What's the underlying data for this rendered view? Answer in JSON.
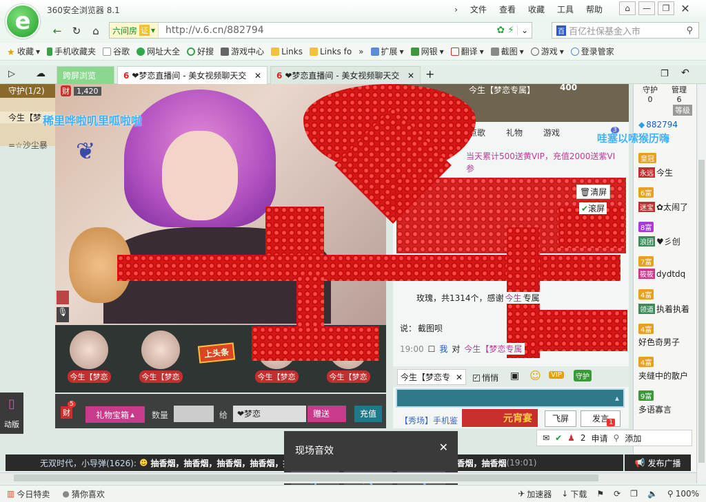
{
  "browser": {
    "title": "360安全浏览器 8.1",
    "logo_letter": "e",
    "menu": [
      "文件",
      "查看",
      "收藏",
      "工具",
      "帮助"
    ],
    "site_badge": "六间房",
    "site_badge_tag": "证",
    "url": "http://v.6.cn/882794",
    "search_placeholder": "百亿社保基金入市",
    "bookmarks": [
      "收藏",
      "手机收藏夹",
      "谷歌",
      "网址大全",
      "好搜",
      "游戏中心",
      "Links",
      "Links fo",
      "扩展",
      "网银",
      "翻译",
      "截图",
      "游戏",
      "登录管家"
    ],
    "tabs": [
      {
        "label": "跨屏浏览"
      },
      {
        "label": "❤梦恋直播间 - 美女视频聊天交"
      },
      {
        "label": "❤梦恋直播间 - 美女视频聊天交"
      }
    ]
  },
  "room": {
    "guard_header": "守护(1/2)",
    "guard_list": [
      "今生【梦",
      "=☆沙尘暴"
    ],
    "fortune_badge": "财",
    "fortune_value": "1,420",
    "scroll_text_left": "稀里哗啦叽里呱啦啦",
    "scroll_text_right": "哇塞以嗦猴历嗨",
    "anchors": [
      "今生【梦恋",
      "今生【梦恋",
      "今生【梦恋",
      "今生【梦恋"
    ],
    "headline_label": "上头条",
    "gift_box": "礼物宝箱",
    "quantity_label": "数量",
    "give_label": "给",
    "recipient": "❤梦恋",
    "send_label": "赠送",
    "recharge_label": "充值",
    "fortune_count": "5",
    "fortune_short": "财"
  },
  "chat": {
    "host_name": "今生【梦恋专属】",
    "host_score": "400",
    "tabs": [
      "点歌",
      "礼物",
      "游戏"
    ],
    "tab_badge": "3",
    "notice": "当天累计500送黄VIP，充值2000送紫VI",
    "notice_more": "参",
    "clear_label": "清屏",
    "scroll_label": "滚屏",
    "msg_rose": "玫瑰，共1314个，感谢",
    "msg_rose_name": "今生",
    "msg_rose_tail": "专属",
    "say_label": "说：",
    "say_text": "截图呗",
    "time": "19:00",
    "me_label": "我",
    "to_label": "对",
    "target": "今生【梦恋专属",
    "target_chip": "今生【梦恋专",
    "whisper_label": "悄悄",
    "vip_label": "VIP",
    "guard_label": "守护",
    "show_label": "【秀场】手机鉴",
    "banquet_label": "元宵宴",
    "fly_label": "飞屏",
    "send_label": "发言",
    "send_badge": "1"
  },
  "users": {
    "guard_count": "守护",
    "guard_num": "0",
    "admin_label": "管理",
    "admin_num": "6",
    "level_label": "等级",
    "room_id": "882794",
    "list": [
      {
        "level": "皇冠",
        "tag": "永远",
        "name": "今生"
      },
      {
        "level": "6富",
        "tag": "迷宝",
        "name": "✿太闹了"
      },
      {
        "level": "8富",
        "tag": "浪团",
        "name": "♥彡创"
      },
      {
        "level": "7富",
        "tag": "筱筱",
        "name": "dydtdq"
      },
      {
        "level": "4富",
        "tag": "领道",
        "name": "执着执着"
      },
      {
        "level": "4富",
        "tag": "",
        "name": "好色奇男子"
      },
      {
        "level": "4富",
        "tag": "",
        "name": "夹缝中的散户"
      },
      {
        "level": "9富",
        "tag": "",
        "name": "多语寡言"
      }
    ],
    "online_count": "2",
    "apply_label": "申请",
    "apply_badge": "1",
    "add_label": "添加"
  },
  "ticker": {
    "prefix": "无双时代，小导弹(1626):",
    "text": "抽香烟，抽香烟，抽香烟，抽香烟，抽香烟，抽香烟，抽香烟，抽香烟，抽香烟，抽香烟，抽香烟",
    "time": "(19:01)",
    "broadcast_label": "发布广播"
  },
  "sfx": {
    "title": "现场音效",
    "buttons": [
      "1",
      "2",
      "3"
    ]
  },
  "side": {
    "mobile_label": "动版"
  },
  "status": {
    "special": "今日特卖",
    "guess": "猜你喜欢",
    "accelerate": "加速器",
    "download": "下载",
    "zoom": "100%"
  }
}
